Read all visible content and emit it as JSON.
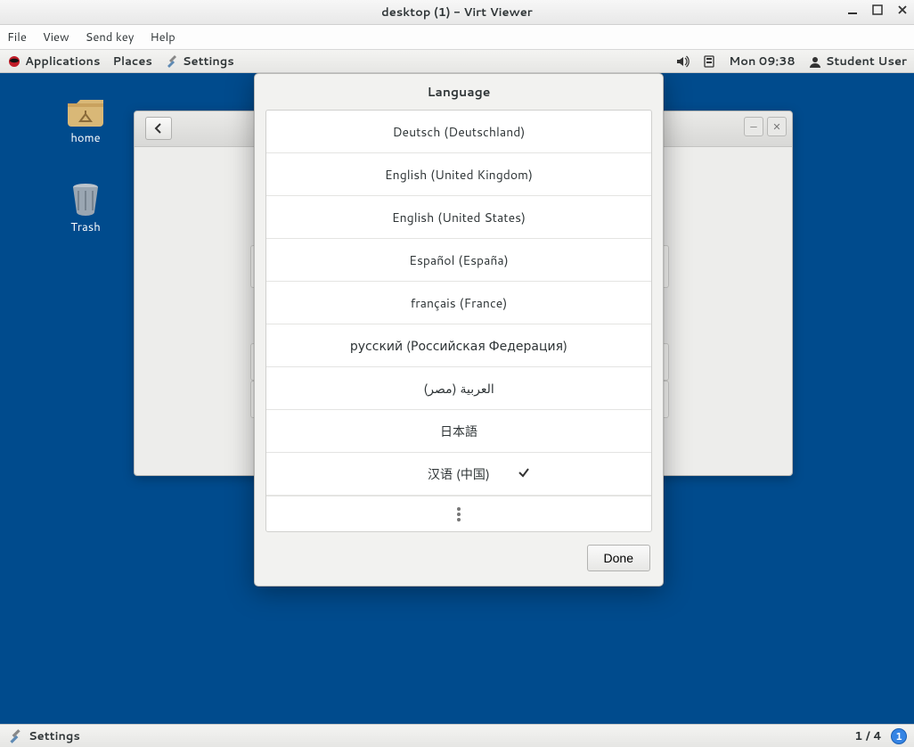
{
  "virt": {
    "title": "desktop (1) - Virt Viewer",
    "menus": {
      "file": "File",
      "view": "View",
      "sendkey": "Send key",
      "help": "Help"
    }
  },
  "topbar": {
    "applications": "Applications",
    "places": "Places",
    "settings": "Settings",
    "clock": "Mon 09:38",
    "user": "Student User"
  },
  "desktop_icons": {
    "home": "home",
    "trash": "Trash"
  },
  "dialog": {
    "title": "Language",
    "languages": [
      "Deutsch (Deutschland)",
      "English (United Kingdom)",
      "English (United States)",
      "Español (España)",
      "français (France)",
      "русский (Российская Федерация)",
      "العربية (مصر)",
      "日本語",
      "汉语 (中国)"
    ],
    "selected_index": 8,
    "done": "Done"
  },
  "bottombar": {
    "task": "Settings",
    "workspace_label": "1 / 4",
    "workspace_current": "1"
  }
}
